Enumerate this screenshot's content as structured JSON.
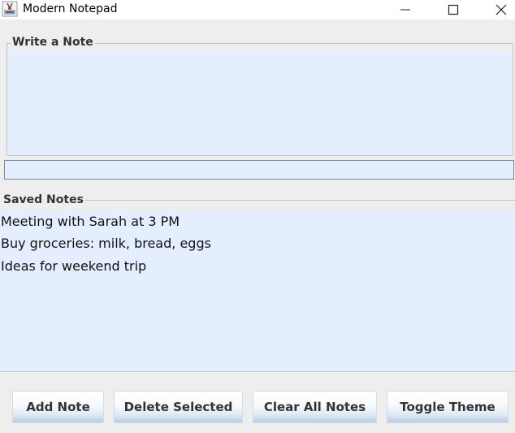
{
  "window": {
    "title": "Modern Notepad",
    "controls": [
      "minimize-icon",
      "maximize-icon",
      "close-icon"
    ]
  },
  "write_section": {
    "label": "Write a Note",
    "note_text": "",
    "input_value": ""
  },
  "saved_section": {
    "label": "Saved Notes",
    "notes": [
      "Meeting with Sarah at 3 PM",
      "Buy groceries: milk, bread, eggs",
      "Ideas for weekend trip"
    ]
  },
  "buttons": {
    "add": "Add Note",
    "delete": "Delete Selected",
    "clear": "Clear All Notes",
    "toggle": "Toggle Theme"
  },
  "colors": {
    "text_area_bg": "#e4eeff",
    "window_bg": "#eeeeee",
    "border": "#b8c4d0"
  }
}
